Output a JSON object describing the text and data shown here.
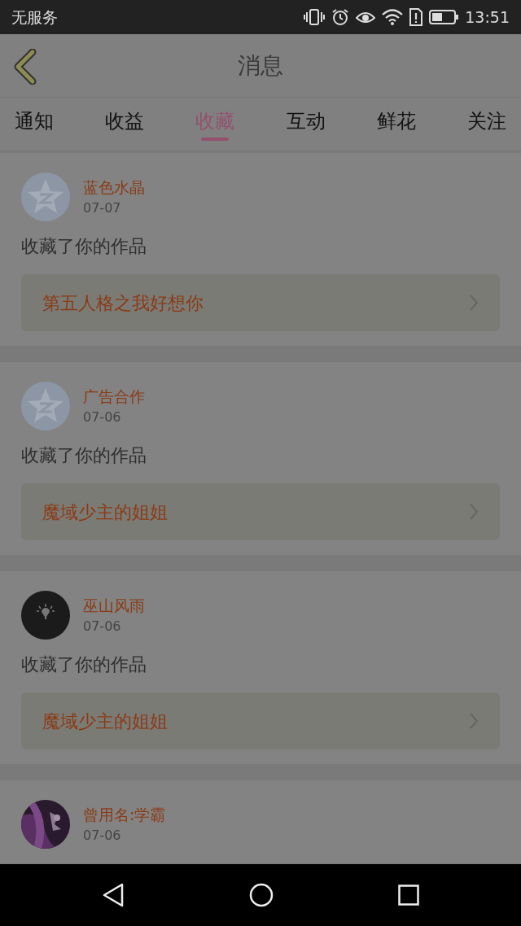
{
  "status_bar": {
    "carrier": "无服务",
    "time": "13:51"
  },
  "header": {
    "title": "消息"
  },
  "tabs": [
    {
      "label": "通知",
      "selected": false
    },
    {
      "label": "收益",
      "selected": false
    },
    {
      "label": "收藏",
      "selected": true
    },
    {
      "label": "互动",
      "selected": false
    },
    {
      "label": "鲜花",
      "selected": false
    },
    {
      "label": "关注",
      "selected": false
    }
  ],
  "messages": [
    {
      "avatar": {
        "kind": "default"
      },
      "name": "蓝色水晶",
      "date": "07-07",
      "text": "收藏了你的作品",
      "work": "第五人格之我好想你"
    },
    {
      "avatar": {
        "kind": "default"
      },
      "name": "广告合作",
      "date": "07-06",
      "text": "收藏了你的作品",
      "work": "魔域少主的姐姐"
    },
    {
      "avatar": {
        "kind": "bulb"
      },
      "name": "巫山风雨",
      "date": "07-06",
      "text": "收藏了你的作品",
      "work": "魔域少主的姐姐"
    },
    {
      "name": "曾用名:学霸",
      "date": "07-06"
    }
  ]
}
